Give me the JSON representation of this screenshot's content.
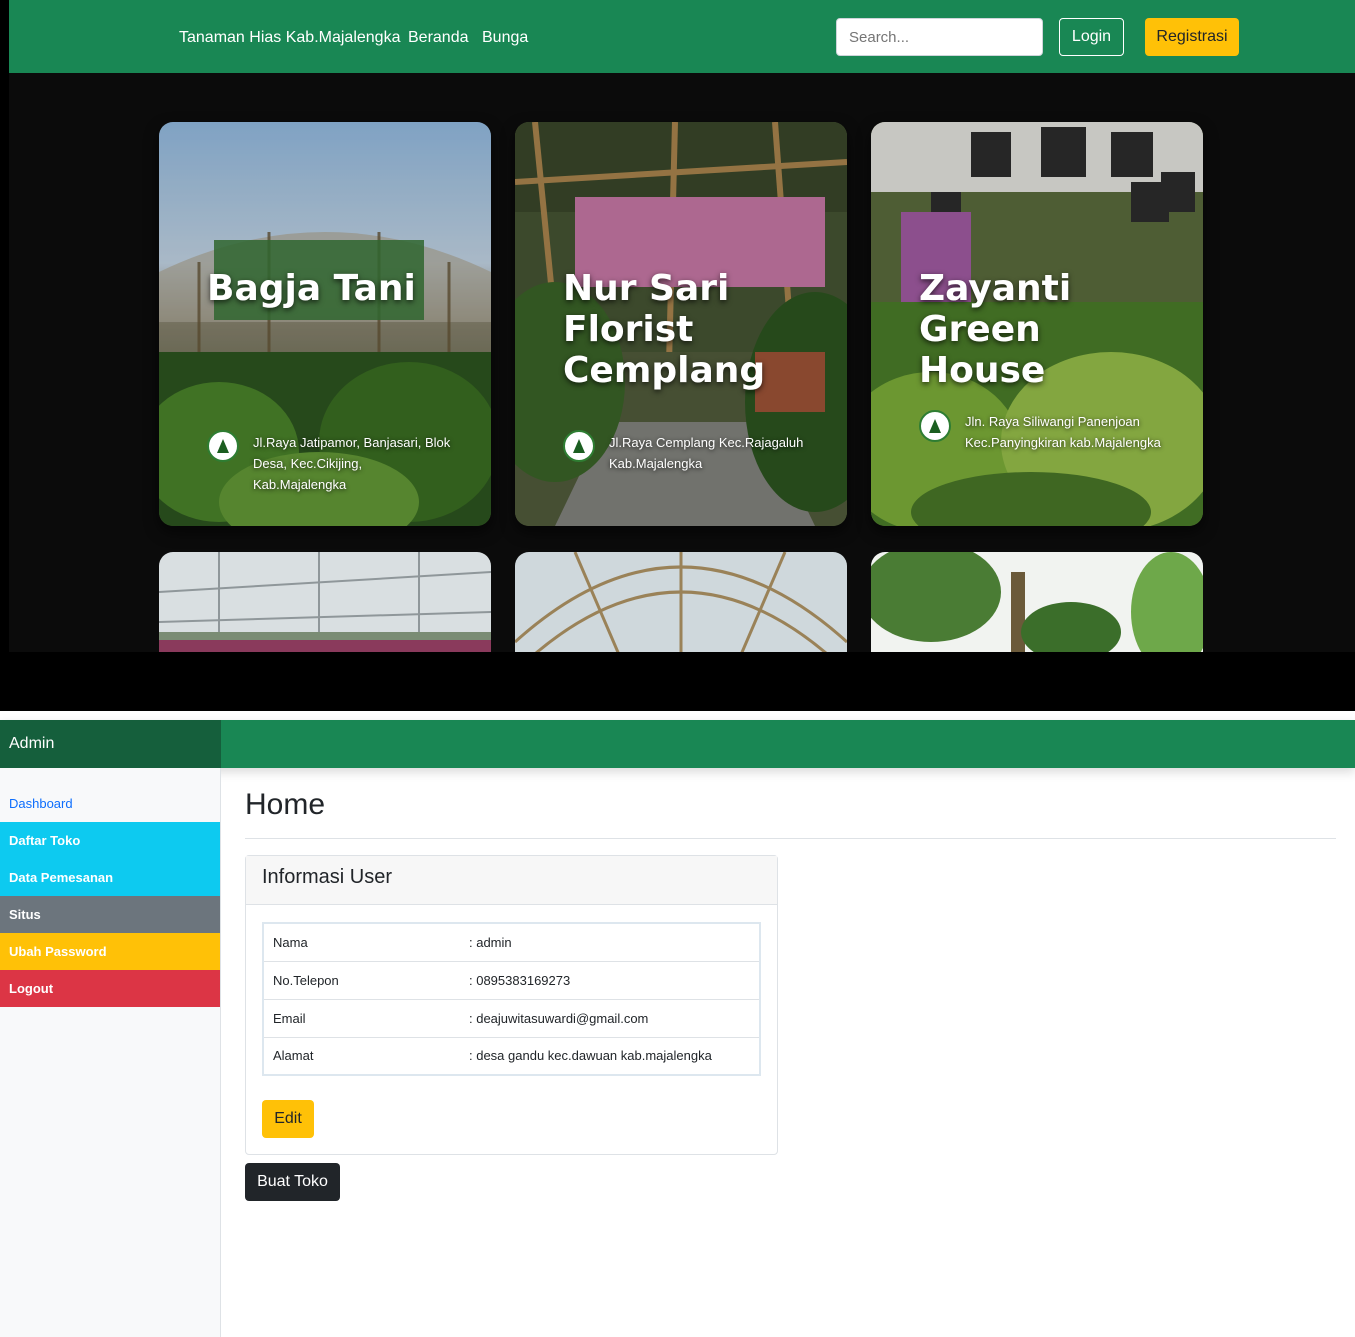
{
  "public_nav": {
    "brand": "Tanaman Hias Kab.Majalengka",
    "links": [
      "Beranda",
      "Bunga"
    ],
    "search_placeholder": "Search...",
    "login_label": "Login",
    "register_label": "Registrasi"
  },
  "cards": [
    {
      "title": "Bagja Tani",
      "address": "Jl.Raya Jatipamor, Banjasari, Blok Desa, Kec.Cikijing, Kab.Majalengka"
    },
    {
      "title": "Nur Sari Florist Cemplang",
      "address": "Jl.Raya Cemplang Kec.Rajagaluh Kab.Majalengka"
    },
    {
      "title": "Zayanti Green House",
      "address": "Jln. Raya Siliwangi Panenjoan Kec.Panyingkiran kab.Majalengka"
    }
  ],
  "admin": {
    "brand": "Admin",
    "sidebar": [
      "Dashboard",
      "Daftar Toko",
      "Data Pemesanan",
      "Situs",
      "Ubah Password",
      "Logout"
    ],
    "page_title": "Home",
    "panel_title": "Informasi User",
    "user_info": [
      {
        "label": "Nama",
        "value": ": admin"
      },
      {
        "label": "No.Telepon",
        "value": ": 0895383169273"
      },
      {
        "label": "Email",
        "value": ": deajuwitasuwardi@gmail.com"
      },
      {
        "label": "Alamat",
        "value": ": desa gandu kec.dawuan kab.majalengka"
      }
    ],
    "edit_label": "Edit",
    "create_shop_label": "Buat Toko"
  }
}
